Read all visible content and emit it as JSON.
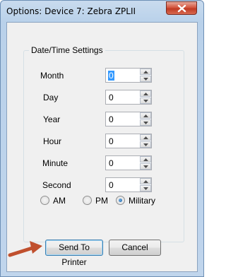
{
  "window": {
    "title": "Options: Device 7: Zebra ZPLII"
  },
  "group": {
    "label": "Date/Time Settings"
  },
  "fields": [
    {
      "label": "Month",
      "value": "0",
      "selected": true
    },
    {
      "label": "Day",
      "value": "0"
    },
    {
      "label": "Year",
      "value": "0"
    },
    {
      "label": "Hour",
      "value": "0"
    },
    {
      "label": "Minute",
      "value": "0"
    },
    {
      "label": "Second",
      "value": "0"
    }
  ],
  "time_format": {
    "options": [
      "AM",
      "PM",
      "Military"
    ],
    "selected": "Military"
  },
  "buttons": {
    "send_label": "Send To Printer",
    "cancel_label": "Cancel"
  },
  "colors": {
    "arrow": "#c0502e",
    "selection": "#3399ff"
  },
  "icons": {
    "close": "close-icon",
    "arrow": "arrow-annotation-icon"
  }
}
